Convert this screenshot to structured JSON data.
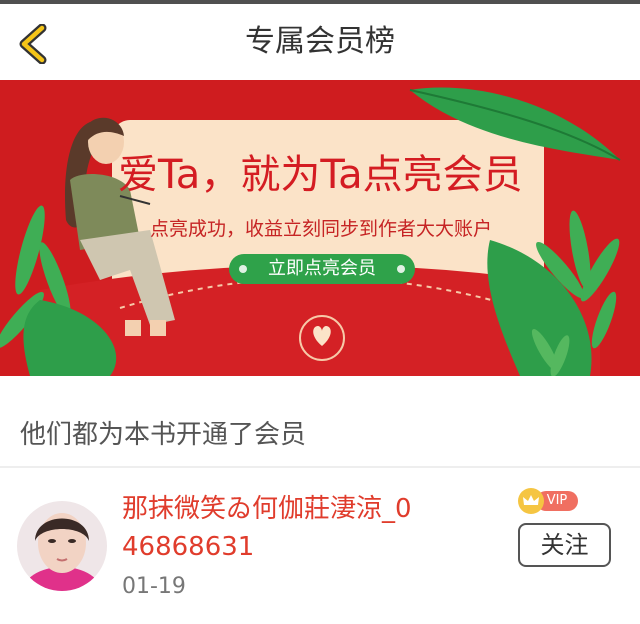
{
  "header": {
    "title": "专属会员榜",
    "back_icon": "chevron-left-icon"
  },
  "banner": {
    "headline": "爱Ta，就为Ta点亮会员",
    "subline": "点亮成功，收益立刻同步到作者大大账户",
    "button_label": "立即点亮会员",
    "seal_icon": "heart-hands-icon"
  },
  "section": {
    "title": "他们都为本书开通了会员"
  },
  "members": [
    {
      "name": "那抹微笑ゐ何伽莊淒涼_046868631",
      "date": "01-19",
      "badge": "VIP",
      "follow_label": "关注"
    }
  ],
  "colors": {
    "banner_red": "#cf1c1f",
    "button_green": "#2fa24a",
    "name_red": "#e03c2c",
    "vip_red": "#f06f61",
    "back_yellow": "#f5c518"
  }
}
